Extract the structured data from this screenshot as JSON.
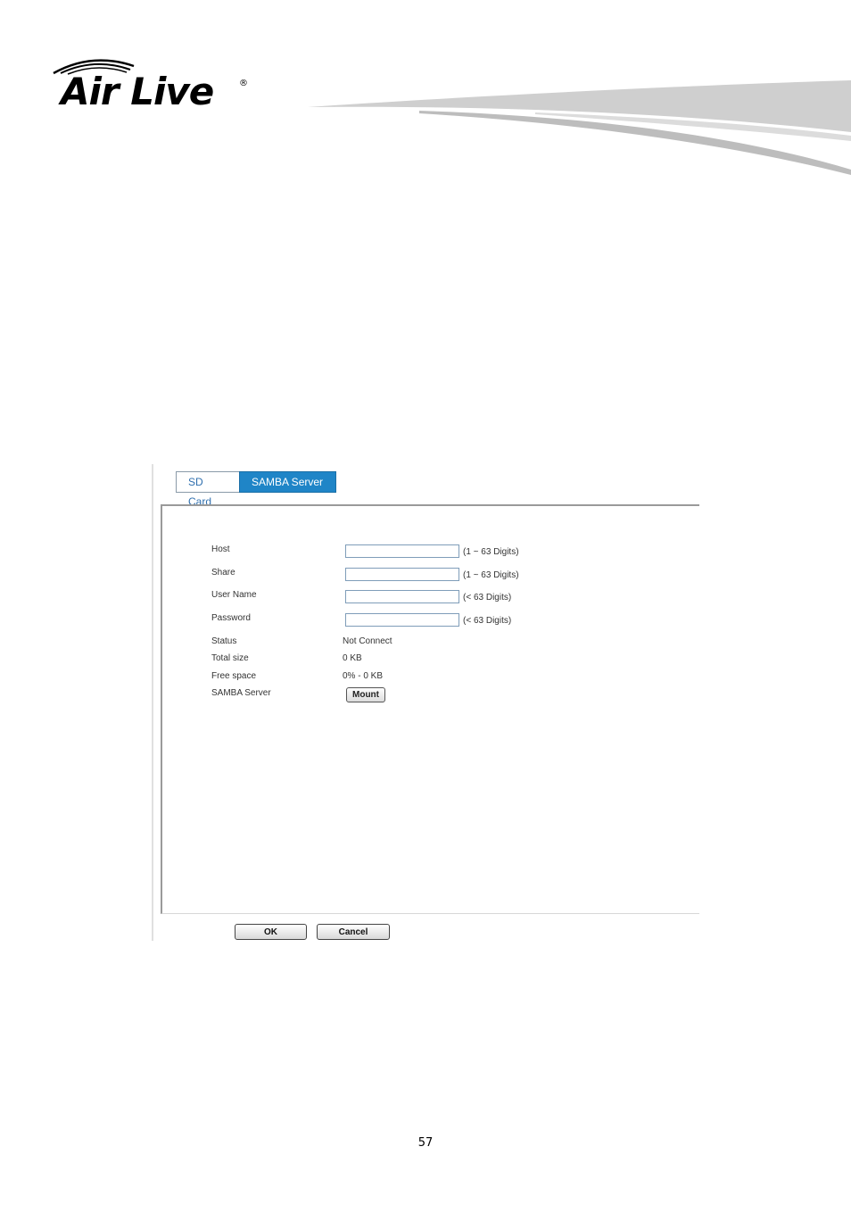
{
  "header": {
    "logo_text": "Air Live",
    "logo_mark": "®"
  },
  "tabs": [
    {
      "label": "SD Card",
      "active": false
    },
    {
      "label": "SAMBA Server",
      "active": true
    }
  ],
  "form": {
    "host": {
      "label": "Host",
      "value": "",
      "hint": "(1 ~ 63 Digits)"
    },
    "share": {
      "label": "Share",
      "value": "",
      "hint": "(1 ~ 63 Digits)"
    },
    "username": {
      "label": "User Name",
      "value": "",
      "hint": "(< 63 Digits)"
    },
    "password": {
      "label": "Password",
      "value": "",
      "hint": "(< 63 Digits)"
    },
    "status": {
      "label": "Status",
      "value": "Not Connect"
    },
    "total_size": {
      "label": "Total size",
      "value": "0 KB"
    },
    "free_space": {
      "label": "Free space",
      "value": "0% - 0 KB"
    },
    "samba_server": {
      "label": "SAMBA Server",
      "button": "Mount"
    }
  },
  "buttons": {
    "ok": "OK",
    "cancel": "Cancel"
  },
  "page_number": "57",
  "colors": {
    "tab_active_bg": "#1f85c7",
    "tab_inactive_text": "#2f6fae",
    "input_border": "#7f9db9"
  }
}
